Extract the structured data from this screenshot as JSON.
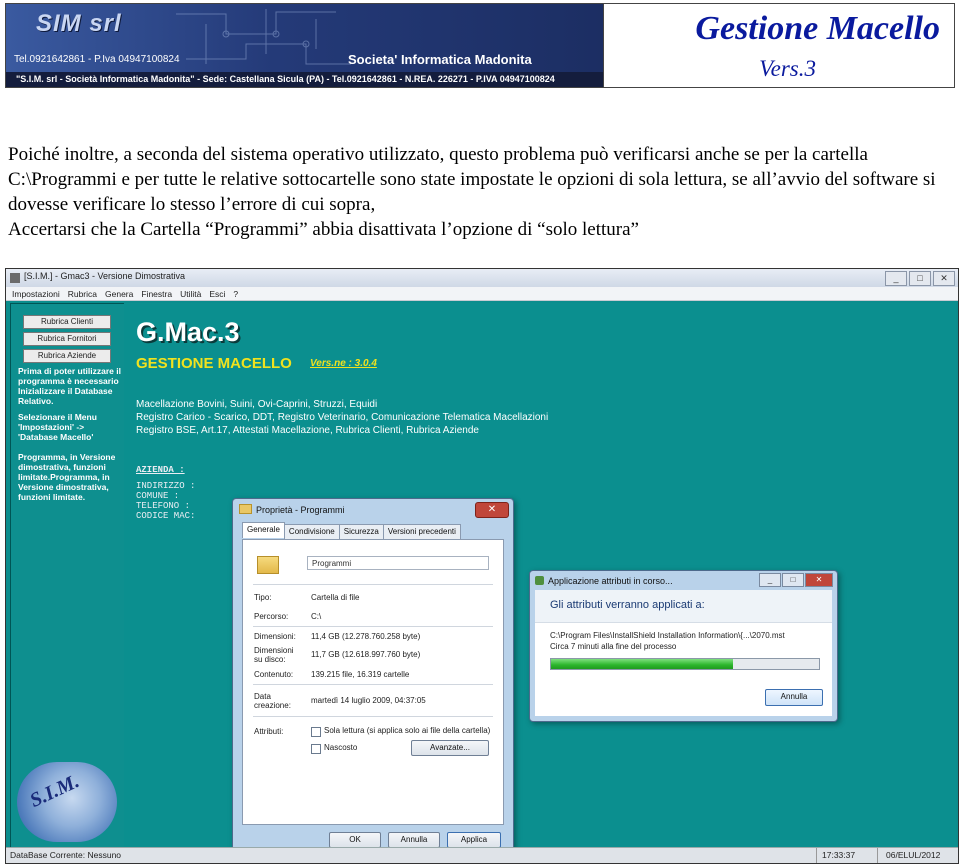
{
  "header": {
    "banner": {
      "logo_text": "SIM srl",
      "contact_line": "Tel.0921642861 - P.Iva 04947100824",
      "company_name": "Societa' Informatica Madonita",
      "bottom_line": "\"S.I.M. srl - Società Informatica Madonita\" - Sede: Castellana Sicula (PA) - Tel.0921642861 - N.REA. 226271 - P.IVA 04947100824"
    },
    "title": "Gestione Macello",
    "version": "Vers.3"
  },
  "paragraph": {
    "text": "Poiché inoltre, a seconda del sistema operativo utilizzato, questo problema può verificarsi anche se per la cartella C:\\Programmi e per tutte le relative sottocartelle sono state impostate le opzioni di sola lettura, se all’avvio del software si dovesse verificare lo stesso l’errore di cui sopra,",
    "last_line": "Accertarsi che la Cartella “Programmi” abbia disattivata l’opzione di “solo lettura”"
  },
  "screenshot": {
    "app": {
      "title": "[S.I.M.] - Gmac3 - Versione Dimostrativa",
      "window_buttons": [
        "_",
        "□",
        "✕"
      ],
      "menu": [
        "Impostazioni",
        "Rubrica",
        "Genera",
        "Finestra",
        "Utilità",
        "Esci",
        "?"
      ]
    },
    "sidebar": {
      "buttons": [
        "Rubrica Clienti",
        "Rubrica Fornitori",
        "Rubrica Aziende"
      ],
      "note1": "Prima di poter utilizzare il programma è necessario Inizializzare il Database Relativo.",
      "note2": "Selezionare il Menu 'Impostazioni' -> 'Database Macello'",
      "note3": "Programma, in Versione dimostrativa, funzioni limitate.Programma, in Versione dimostrativa, funzioni limitate.",
      "logo_text": "S.I.M."
    },
    "main": {
      "app_name": "G.Mac.3",
      "subtitle": "GESTIONE MACELLO",
      "version": "Vers.ne : 3.0.4",
      "desc": [
        "Macellazione Bovini, Suini, Ovi-Caprini, Struzzi, Equidi",
        "Registro Carico - Scarico, DDT, Registro Veterinario, Comunicazione Telematica Macellazioni",
        "Registro BSE, Art.17, Attestati Macellazione, Rubrica Clienti, Rubrica Aziende"
      ],
      "azienda_header": "AZIENDA   :",
      "azienda_fields": [
        "INDIRIZZO :",
        "COMUNE    :",
        "TELEFONO  :",
        "CODICE MAC:"
      ]
    },
    "properties_dialog": {
      "title": "Proprietà - Programmi",
      "close_label": "✕",
      "tabs": [
        "Generale",
        "Condivisione",
        "Sicurezza",
        "Versioni precedenti"
      ],
      "folder_name": "Programmi",
      "rows": [
        {
          "label": "Tipo:",
          "value": "Cartella di file"
        },
        {
          "label": "Percorso:",
          "value": "C:\\"
        },
        {
          "label": "Dimensioni:",
          "value": "11,4 GB (12.278.760.258 byte)"
        },
        {
          "label": "Dimensioni su disco:",
          "value": "11,7 GB (12.618.997.760 byte)"
        },
        {
          "label": "Contenuto:",
          "value": "139.215 file, 16.319 cartelle"
        },
        {
          "label": "Data creazione:",
          "value": "martedì 14 luglio 2009, 04:37:05"
        }
      ],
      "attributes_label": "Attributi:",
      "readonly_label": "Sola lettura (si applica solo ai file della cartella)",
      "hidden_label": "Nascosto",
      "advanced_button": "Avanzate...",
      "buttons": [
        "OK",
        "Annulla",
        "Applica"
      ]
    },
    "apply_dialog": {
      "title": "Applicazione attributi in corso...",
      "heading": "Gli attributi verranno applicati a:",
      "path": "C:\\Program Files\\InstallShield Installation Information\\{...\\2070.mst",
      "time_left": "Circa 7 minuti alla fine del processo",
      "progress": 0.68,
      "cancel_button": "Annulla"
    },
    "status_bar": {
      "db": "DataBase Corrente: Nessuno",
      "time": "17:33:37",
      "date": "06/ELUL/2012"
    }
  },
  "colors": {
    "app_background": "#0b8d8d",
    "header_title": "#0a1a9e",
    "subtitle_yellow": "#f1e21e",
    "progress_green": "#2bb52b"
  }
}
